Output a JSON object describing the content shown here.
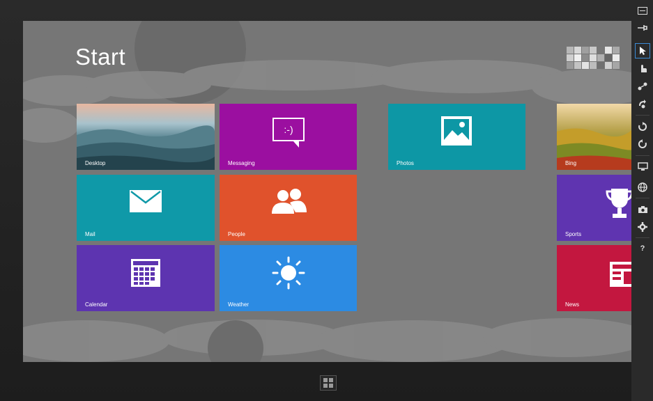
{
  "screen": {
    "title": "Start"
  },
  "tiles": {
    "desktop": "Desktop",
    "messaging": "Messaging",
    "photos": "Photos",
    "bing": "Bing",
    "mail": "Mail",
    "people": "People",
    "sports": "Sports",
    "calendar": "Calendar",
    "weather": "Weather",
    "news": "News",
    "messaging_glyph": ":-)"
  },
  "toolbar": {
    "icons": [
      "minimize-icon",
      "pin-icon",
      "pointer-icon",
      "touch-hand-icon",
      "pinch-zoom-icon",
      "rotate-touch-icon",
      "rotate-clockwise-icon",
      "rotate-counterclockwise-icon",
      "resolution-icon",
      "location-icon",
      "screenshot-icon",
      "settings-icon",
      "help-icon"
    ],
    "help_label": "?"
  },
  "colors": {
    "background": "#767676",
    "messaging": "#9b0fa0",
    "photos": "#0d97a5",
    "mail": "#0f99a8",
    "people": "#e0522c",
    "calendar": "#5d34b0",
    "weather": "#2c8be3",
    "sports": "#5f34b0",
    "news": "#c3173f"
  }
}
